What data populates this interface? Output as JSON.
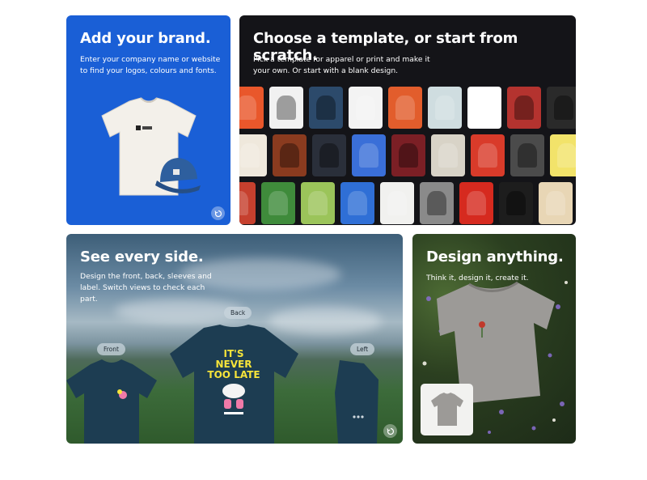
{
  "brand": {
    "title": "Add your brand.",
    "subtitle": "Enter your company name or website to find your logos, colours and fonts."
  },
  "templates": {
    "title": "Choose a template, or start from scratch.",
    "subtitle": "Pick a template for apparel or print and make it your own. Or start with a blank design.",
    "rows": [
      [
        "#e9572b",
        "#f1f1f1",
        "#2c4a6b",
        "#f3f3f3",
        "#e25d2c",
        "#cfdde0",
        "#ffffff",
        "#b4332f",
        "#2a2a2a"
      ],
      [
        "#efe8dc",
        "#8a3b1f",
        "#2a2f3a",
        "#3a6fd8",
        "#7b1f25",
        "#d8d3c7",
        "#d93b2a",
        "#4b4b4b",
        "#f2e36a"
      ],
      [
        "#c6402e",
        "#3f8b3b",
        "#9bc45a",
        "#2f6fd6",
        "#f1f1ef",
        "#8a8a8a",
        "#d62a1f",
        "#1d1d1d",
        "#e8d6b5",
        "#3c3c3c"
      ]
    ],
    "row_dark": [
      [
        false,
        true,
        true,
        false,
        false,
        false,
        false,
        true,
        true
      ],
      [
        false,
        true,
        true,
        false,
        true,
        false,
        false,
        true,
        false
      ],
      [
        false,
        false,
        false,
        false,
        false,
        true,
        false,
        true,
        false,
        true
      ]
    ]
  },
  "sides": {
    "title": "See every side.",
    "subtitle": "Design the front, back, sleeves and label. Switch views to check each part.",
    "views": [
      "Front",
      "Back",
      "Left"
    ],
    "back_print": [
      "IT'S",
      "NEVER",
      "TOO LATE"
    ]
  },
  "design": {
    "title": "Design anything.",
    "subtitle": "Think it, design it, create it."
  },
  "colors": {
    "brand_blue": "#1a5fd6",
    "template_bg": "#141418",
    "tee_navy": "#1d3d52",
    "print_yellow": "#f6e43a"
  }
}
